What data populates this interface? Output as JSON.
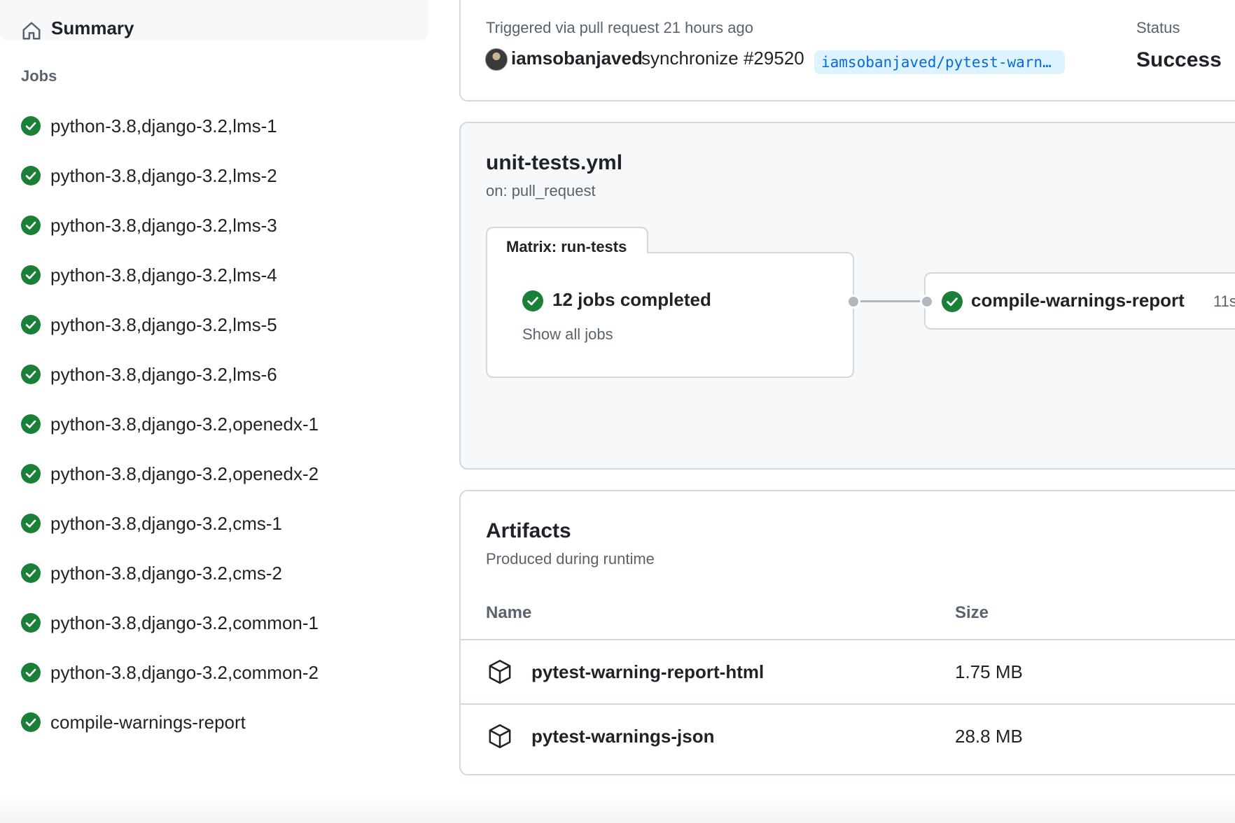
{
  "sidebar": {
    "summary_label": "Summary",
    "jobs_heading": "Jobs",
    "jobs": [
      {
        "label": "python-3.8,django-3.2,lms-1",
        "status": "success"
      },
      {
        "label": "python-3.8,django-3.2,lms-2",
        "status": "success"
      },
      {
        "label": "python-3.8,django-3.2,lms-3",
        "status": "success"
      },
      {
        "label": "python-3.8,django-3.2,lms-4",
        "status": "success"
      },
      {
        "label": "python-3.8,django-3.2,lms-5",
        "status": "success"
      },
      {
        "label": "python-3.8,django-3.2,lms-6",
        "status": "success"
      },
      {
        "label": "python-3.8,django-3.2,openedx-1",
        "status": "success"
      },
      {
        "label": "python-3.8,django-3.2,openedx-2",
        "status": "success"
      },
      {
        "label": "python-3.8,django-3.2,cms-1",
        "status": "success"
      },
      {
        "label": "python-3.8,django-3.2,cms-2",
        "status": "success"
      },
      {
        "label": "python-3.8,django-3.2,common-1",
        "status": "success"
      },
      {
        "label": "python-3.8,django-3.2,common-2",
        "status": "success"
      },
      {
        "label": "compile-warnings-report",
        "status": "success"
      }
    ]
  },
  "trigger": {
    "text": "Triggered via pull request 21 hours ago",
    "actor": "iamsobanjaved",
    "event": "synchronize #29520",
    "branch": "iamsobanjaved/pytest-warn…",
    "status_label": "Status",
    "status_value": "Success"
  },
  "workflow": {
    "file": "unit-tests.yml",
    "on": "on: pull_request",
    "matrix_label": "Matrix: run-tests",
    "matrix_completed": "12 jobs completed",
    "show_all": "Show all jobs",
    "node_label": "compile-warnings-report",
    "node_duration": "11s"
  },
  "artifacts": {
    "title": "Artifacts",
    "subtitle": "Produced during runtime",
    "col_name": "Name",
    "col_size": "Size",
    "rows": [
      {
        "name": "pytest-warning-report-html",
        "size": "1.75 MB"
      },
      {
        "name": "pytest-warnings-json",
        "size": "28.8 MB"
      }
    ]
  },
  "colors": {
    "success": "#1a7f37",
    "link": "#0969da",
    "branch_bg": "#ddf4ff",
    "border": "#d1d9e0"
  },
  "icons": [
    "home-icon",
    "check-circle-icon",
    "package-icon"
  ]
}
